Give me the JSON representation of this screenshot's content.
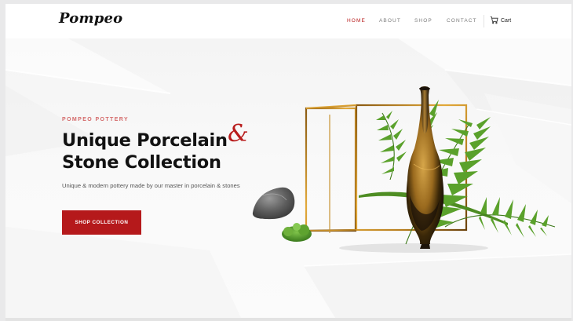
{
  "brand": {
    "logo": "Pompeo"
  },
  "nav": {
    "items": [
      {
        "label": "HOME",
        "active": true
      },
      {
        "label": "ABOUT",
        "active": false
      },
      {
        "label": "SHOP",
        "active": false
      },
      {
        "label": "CONTACT",
        "active": false
      }
    ],
    "cart_label": "Cart",
    "cart_icon": "cart-icon"
  },
  "hero": {
    "eyebrow": "POMPEO POTTERY",
    "title_line1": "Unique Porcelain",
    "title_line2": "Stone Collection",
    "ampersand": "&",
    "subtitle": "Unique & modern pottery made by our master in porcelain & stones",
    "cta_label": "SHOP COLLECTION"
  },
  "colors": {
    "accent": "#b5191b",
    "eyebrow": "#d46a6a",
    "nav_active": "#b81c1c"
  }
}
